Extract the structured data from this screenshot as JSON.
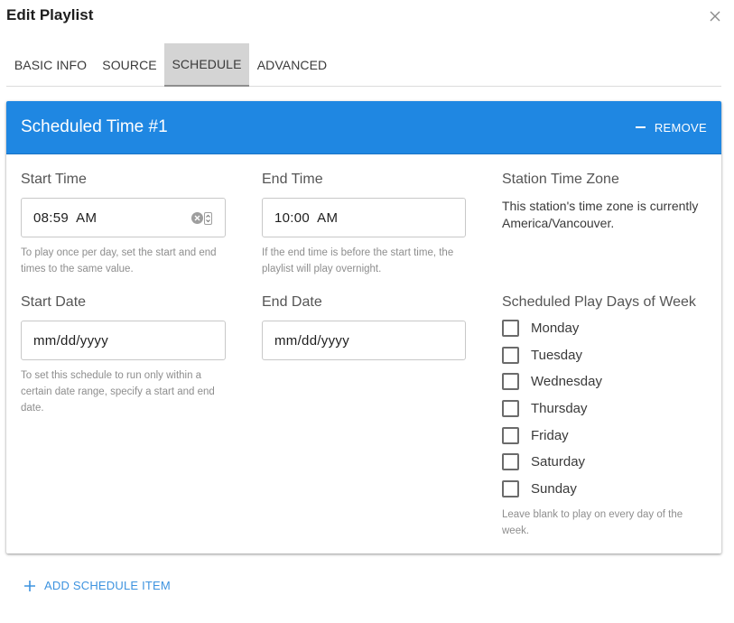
{
  "dialog": {
    "title": "Edit Playlist"
  },
  "tabs": [
    {
      "label": "BASIC INFO"
    },
    {
      "label": "SOURCE"
    },
    {
      "label": "SCHEDULE",
      "active": true
    },
    {
      "label": "ADVANCED"
    }
  ],
  "schedule_item": {
    "title": "Scheduled Time #1",
    "remove_label": "REMOVE",
    "start_time": {
      "label": "Start Time",
      "value": "08:59  AM",
      "help": "To play once per day, set the start and end times to the same value."
    },
    "end_time": {
      "label": "End Time",
      "value": "10:00  AM",
      "help": "If the end time is before the start time, the playlist will play overnight."
    },
    "time_zone": {
      "label": "Station Time Zone",
      "text": "This station's time zone is currently America/Vancouver."
    },
    "start_date": {
      "label": "Start Date",
      "placeholder": "mm/dd/yyyy",
      "help": "To set this schedule to run only within a certain date range, specify a start and end date."
    },
    "end_date": {
      "label": "End Date",
      "placeholder": "mm/dd/yyyy"
    },
    "days": {
      "label": "Scheduled Play Days of Week",
      "items": [
        {
          "label": "Monday",
          "checked": false
        },
        {
          "label": "Tuesday",
          "checked": false
        },
        {
          "label": "Wednesday",
          "checked": false
        },
        {
          "label": "Thursday",
          "checked": false
        },
        {
          "label": "Friday",
          "checked": false
        },
        {
          "label": "Saturday",
          "checked": false
        },
        {
          "label": "Sunday",
          "checked": false
        }
      ],
      "help": "Leave blank to play on every day of the week."
    }
  },
  "add_item_label": "ADD SCHEDULE ITEM",
  "colors": {
    "header_blue": "#1f87e2",
    "link_blue": "#3d93df",
    "active_tab_bg": "#d4d4d4"
  },
  "icons": {
    "close": "close-icon",
    "remove": "minus-icon",
    "clear": "clear-icon",
    "spinner": "spinner-icon",
    "add": "plus-icon"
  }
}
